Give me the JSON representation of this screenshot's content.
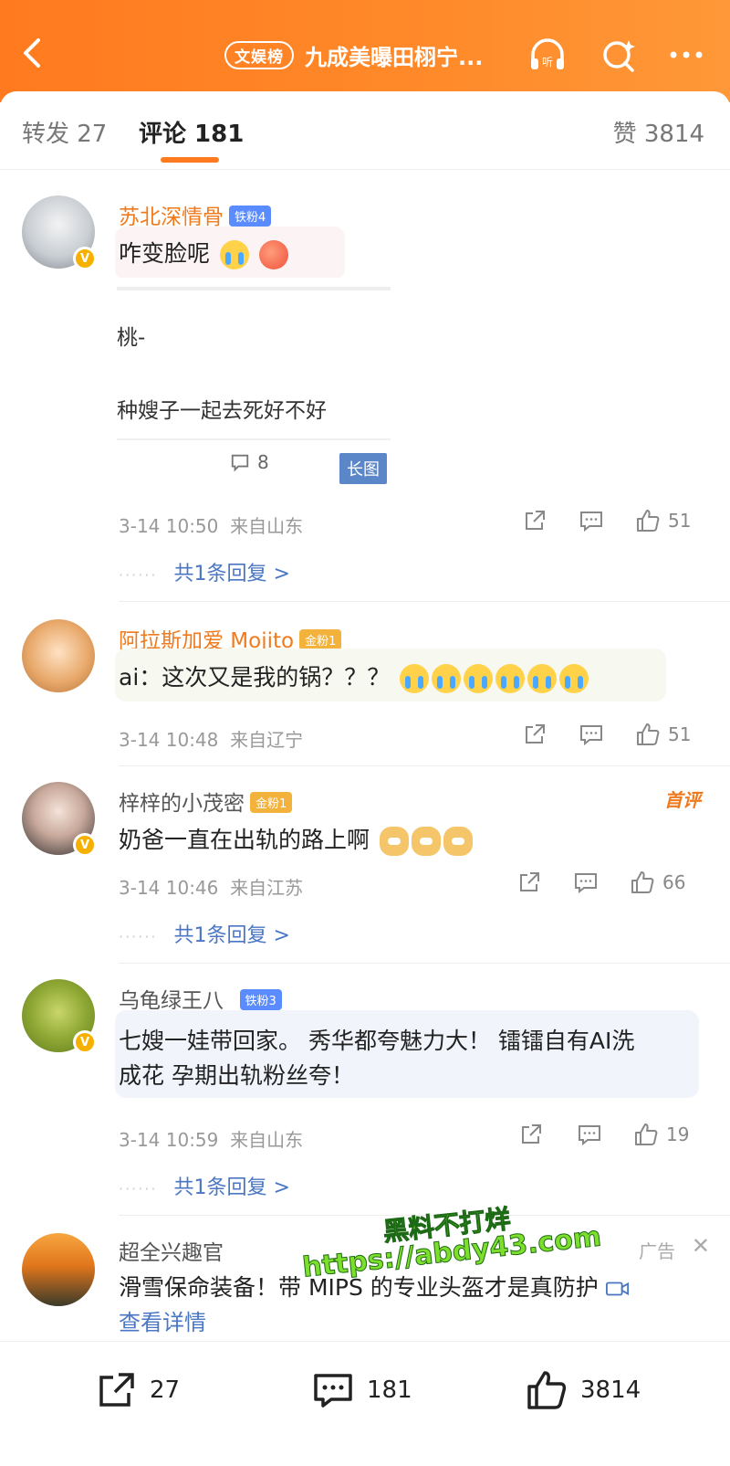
{
  "header": {
    "badge": "文娱榜",
    "title": "九成美曝田栩宁..."
  },
  "tabs": {
    "repost": "转发 27",
    "comments": "评论 181",
    "likes": "赞 3814"
  },
  "comments": [
    {
      "username": "苏北深情骨",
      "fan_badge": "铁粉4",
      "text": "咋变脸呢",
      "embed": {
        "line1": "桃-",
        "line2": "种嫂子一起去死好不好",
        "count": "8",
        "long_tag": "长图"
      },
      "time": "3-14 10:50",
      "location": "来自山东",
      "likes": "51",
      "replies": "共1条回复 >"
    },
    {
      "username": "阿拉斯加爱 Mojito",
      "fan_badge": "金粉1",
      "text": "ai：这次又是我的锅？？？",
      "time": "3-14 10:48",
      "location": "来自辽宁",
      "likes": "51"
    },
    {
      "username": "梓梓的小茂密",
      "fan_badge": "金粉1",
      "tag": "首评",
      "text": "奶爸一直在出轨的路上啊",
      "time": "3-14 10:46",
      "location": "来自江苏",
      "likes": "66",
      "replies": "共1条回复 >"
    },
    {
      "username": "乌龟绿王八_",
      "fan_badge": "铁粉3",
      "text_line1": "七嫂一娃带回家。 秀华都夸魅力大！ 镭镭自有AI洗",
      "text_line2": "成花  孕期出轨粉丝夸！",
      "time": "3-14 10:59",
      "location": "来自山东",
      "likes": "19",
      "replies": "共1条回复 >"
    }
  ],
  "ad": {
    "username": "超全兴趣官",
    "tag": "广告",
    "close": "✕",
    "text": "滑雪保命装备！带 MIPS 的专业头盔才是真防护",
    "link": "查看详情"
  },
  "watermark": {
    "line1": "黑料不打烊",
    "line2": "https://abdy43.com"
  },
  "bottom_bar": {
    "repost": "27",
    "comments": "181",
    "likes": "3814"
  },
  "colors": {
    "brand_orange": "#ff7a1e",
    "link_blue": "#4a76c4"
  }
}
